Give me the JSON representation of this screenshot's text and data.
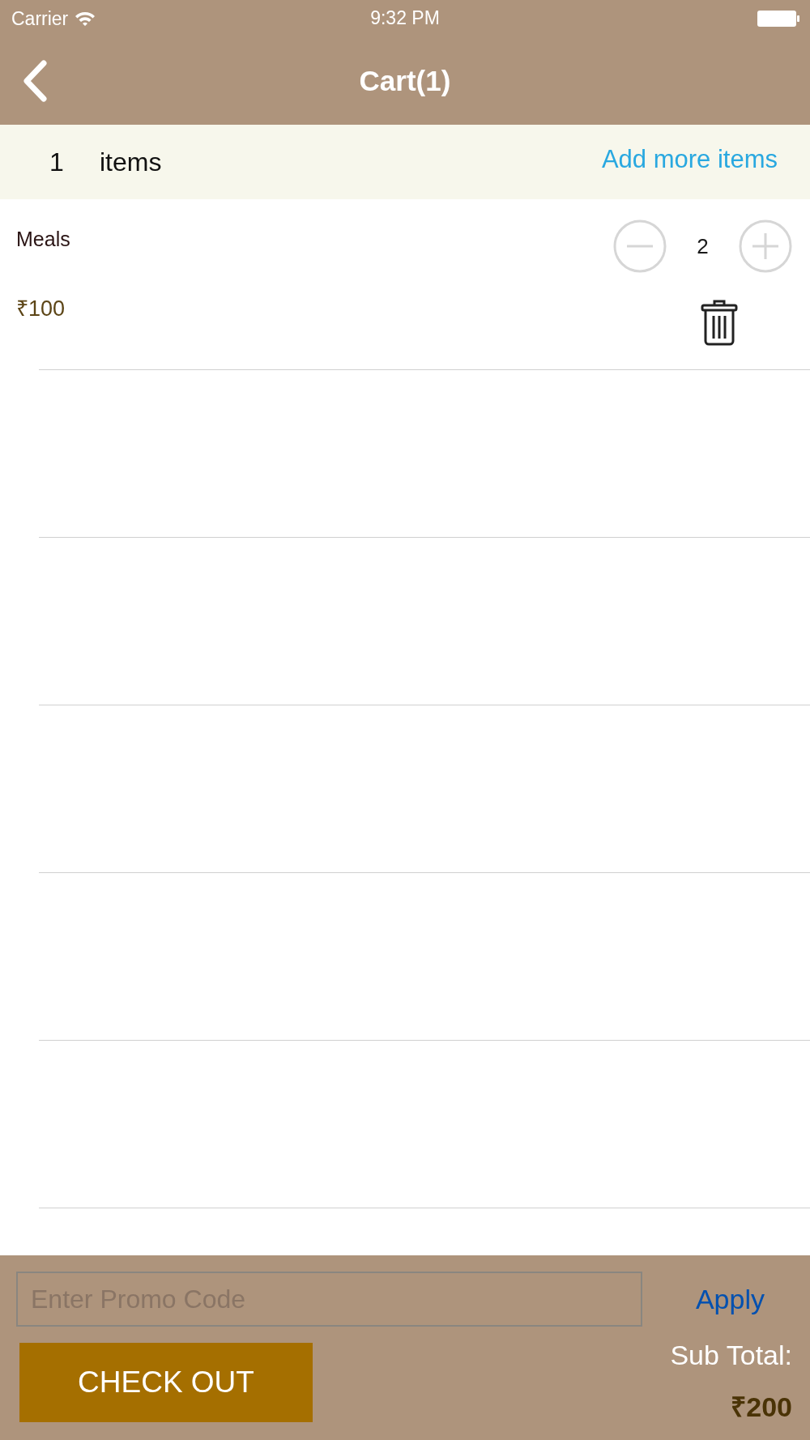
{
  "status_bar": {
    "carrier": "Carrier",
    "time": "9:32 PM"
  },
  "nav_bar": {
    "title": "Cart(1)"
  },
  "summary": {
    "count": "1",
    "label": "items",
    "add_more": "Add more items"
  },
  "items": [
    {
      "name": "Meals",
      "price": "₹100",
      "quantity": "2"
    }
  ],
  "footer": {
    "promo": {
      "placeholder": "Enter Promo Code"
    },
    "apply": "Apply",
    "checkout": "CHECK OUT",
    "subtotal_label": "Sub Total:",
    "subtotal": "₹200"
  }
}
